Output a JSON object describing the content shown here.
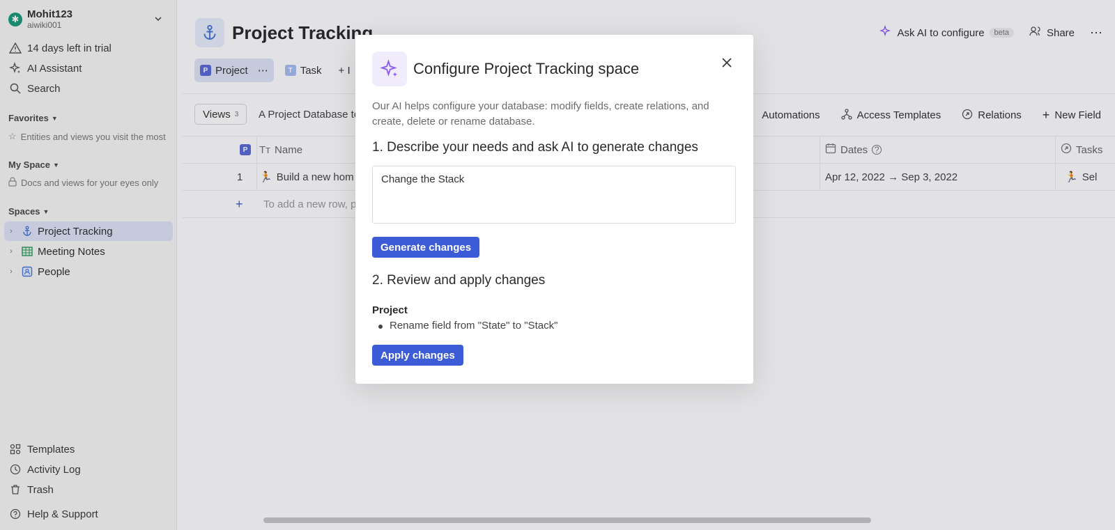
{
  "workspace": {
    "name": "Mohit123",
    "sub": "aiwiki001"
  },
  "sidebar": {
    "trial": "14 days left in trial",
    "ai_assistant": "AI Assistant",
    "search": "Search",
    "favorites_title": "Favorites",
    "favorites_sub": "Entities and views you visit the most",
    "myspace_title": "My Space",
    "myspace_sub": "Docs and views for your eyes only",
    "spaces_title": "Spaces",
    "spaces": [
      {
        "label": "Project Tracking",
        "icon": "anchor-icon"
      },
      {
        "label": "Meeting Notes",
        "icon": "table-icon"
      },
      {
        "label": "People",
        "icon": "contact-card-icon"
      }
    ],
    "templates": "Templates",
    "activity_log": "Activity Log",
    "trash": "Trash",
    "help": "Help & Support"
  },
  "main": {
    "title": "Project Tracking",
    "ask_ai": "Ask AI to configure",
    "beta": "beta",
    "share": "Share",
    "tabs": [
      {
        "badge": "P",
        "label": "Project",
        "color": "#5b6ad6"
      },
      {
        "badge": "T",
        "label": "Task",
        "color": "#9fb6f0"
      },
      {
        "label": "+ I"
      }
    ],
    "views_label": "Views",
    "views_count": "3",
    "db_description": "A Project Database to",
    "toolbar": [
      "Automations",
      "Access Templates",
      "Relations",
      "New Field"
    ],
    "columns": {
      "badge": "P",
      "name": "Name",
      "dates": "Dates",
      "tasks": "Tasks"
    },
    "rows": [
      {
        "num": "1",
        "name": "Build a new hom",
        "dates": "Apr 12, 2022 → Sep 3, 2022",
        "tasks": "Sel"
      }
    ],
    "add_row_placeholder": "To add a new row, pr"
  },
  "modal": {
    "title": "Configure Project Tracking space",
    "description": "Our AI helps configure your database: modify fields, create relations, and create, delete or rename database.",
    "step1": "1. Describe your needs and ask AI to generate changes",
    "input_value": "Change the Stack",
    "generate_label": "Generate changes",
    "step2": "2. Review and apply changes",
    "entity": "Project",
    "change": "Rename field from \"State\" to \"Stack\"",
    "apply_label": "Apply changes"
  },
  "colors": {
    "accent": "#3c5bd6",
    "active_bg": "#dfe4f6"
  }
}
